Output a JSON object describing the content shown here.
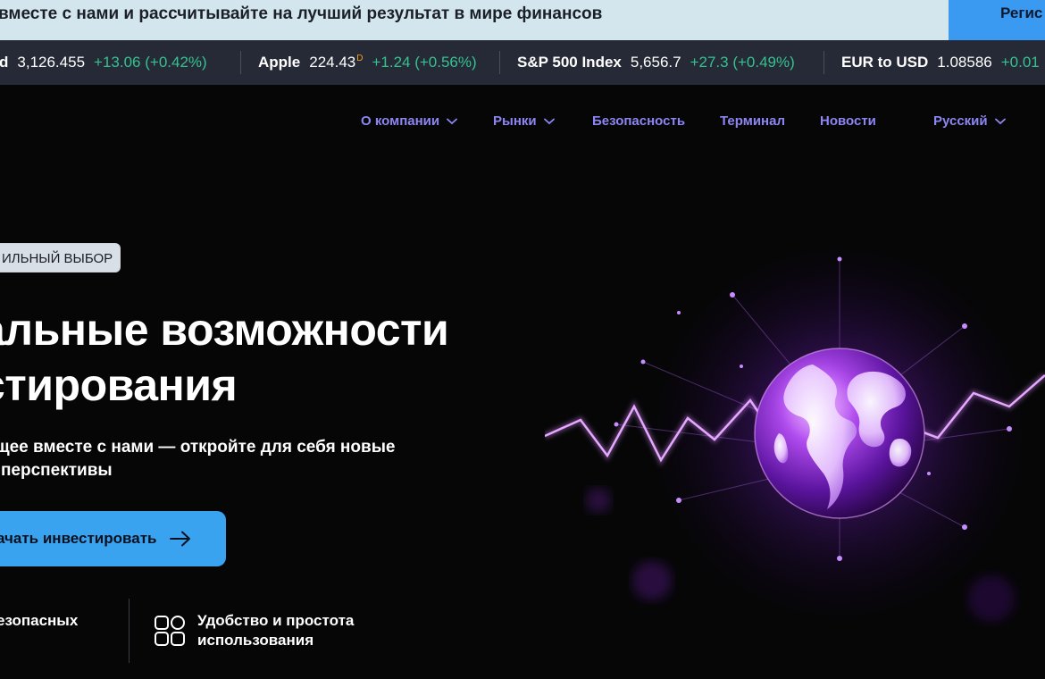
{
  "promo": {
    "text": "вместе с нами и рассчитывайте на лучший результат в мире финансов",
    "button_label": "Регис"
  },
  "ticker": [
    {
      "name": "d",
      "price": "3,126.455",
      "sup": "",
      "change": "+13.06 (+0.42%)"
    },
    {
      "name": "Apple",
      "price": "224.43",
      "sup": "D",
      "change": "+1.24 (+0.56%)"
    },
    {
      "name": "S&P 500 Index",
      "price": "5,656.7",
      "sup": "",
      "change": "+27.3 (+0.49%)"
    },
    {
      "name": "EUR to USD",
      "price": "1.08586",
      "sup": "",
      "change": "+0.01"
    }
  ],
  "nav": {
    "about": "О компании",
    "markets": "Рынки",
    "security": "Безопасность",
    "terminal": "Терминал",
    "news": "Новости",
    "language": "Русский"
  },
  "hero": {
    "badge": "ИЛЬНЫЙ ВЫБОР",
    "title_line1": "альные возможности",
    "title_line2": "стирования",
    "subtitle_line1": "ущее вместе с нами — откройте для себя новые",
    "subtitle_line2": "и перспективы",
    "cta_label": "ачать инвестировать"
  },
  "features": {
    "left": "езопасных",
    "right_line1": "Удобство и простота",
    "right_line2": "использования"
  },
  "colors": {
    "accent": "#3aa3ef",
    "nav": "#8d86f2",
    "positive": "#35c290",
    "glow": "#b44cff"
  },
  "icons": [
    "chevron-down-icon",
    "arrow-right-icon",
    "grid-icon",
    "globe-illustration"
  ]
}
